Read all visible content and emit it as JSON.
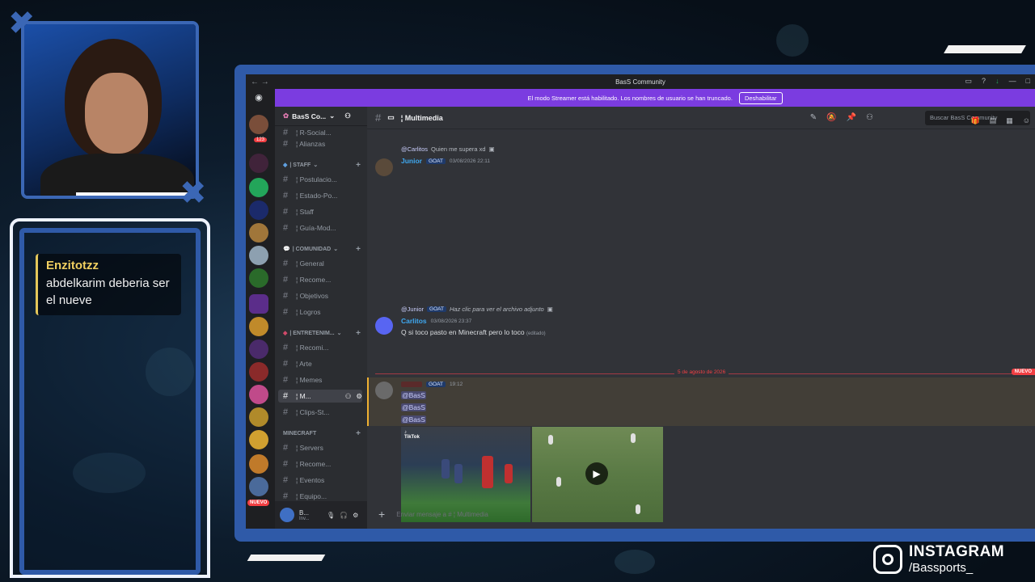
{
  "overlay": {
    "chat_user": "Enzitotzz",
    "chat_message": "abdelkarim deberia ser el nueve",
    "instagram_title": "INSTAGRAM",
    "instagram_handle": "/Bassports_"
  },
  "discord": {
    "window_title": "BasS Community",
    "streamer_notice": "El modo Streamer está habilitado. Los nombres de usuario se han truncado.",
    "streamer_button": "Deshabilitar",
    "server_badge": "123",
    "new_badge": "NUEVO",
    "guild_name": "BasS Co...",
    "channels": [
      {
        "label": "¦ R-Social..."
      },
      {
        "label": "¦ Alianzas"
      }
    ],
    "categories": {
      "staff": "| STAFF",
      "comunidad": "| COMUNIDAD",
      "entretenimiento": "| ENTRETENIM...",
      "minecraft": "MINECRAFT"
    },
    "staff_channels": [
      "¦ Postulacio...",
      "¦ Estado-Po...",
      "¦ Staff",
      "¦ Guía-Mod..."
    ],
    "comunidad_channels": [
      "¦ General",
      "¦ Recome...",
      "¦ Objetivos",
      "¦ Logros"
    ],
    "entretenimiento_channels": [
      "¦ Recomi...",
      "¦ Arte",
      "¦ Memes",
      "¦ M...",
      "¦ Clips-St..."
    ],
    "minecraft_channels": [
      "¦ Servers",
      "¦ Recome...",
      "¦ Eventos",
      "¦ Equipo..."
    ],
    "user_bar": {
      "name": "B...",
      "status": "Inv..."
    },
    "channel_title": "¦ Multimedia",
    "search_placeholder": "Buscar BasS Community",
    "messages": {
      "m1_reply_mention": "@Carlitos",
      "m1_reply_text": "Quien me supera xd",
      "m1_author": "Junior",
      "m1_tag": "GOAT",
      "m1_time": "03/08/2026 22:11",
      "m2_reply_mention": "@Junior",
      "m2_reply_tag": "GOAT",
      "m2_reply_text": "Haz clic para ver el archivo adjunto",
      "m2_author": "Carlitos",
      "m2_time": "03/08/2026 23:37",
      "m2_text": "Q si toco pasto en Minecraft pero lo toco",
      "m2_edited": "(editado)",
      "divider_date": "5 de agosto de 2026",
      "divider_new": "NUEVO",
      "m3_tag": "GOAT",
      "m3_time": "19:12",
      "m3_mentions": [
        "@BasS",
        "@BasS",
        "@BasS"
      ],
      "tiktok_label": "TikTok"
    },
    "composer_placeholder": "Enviar mensaje a #  ¦ Multimedia"
  }
}
